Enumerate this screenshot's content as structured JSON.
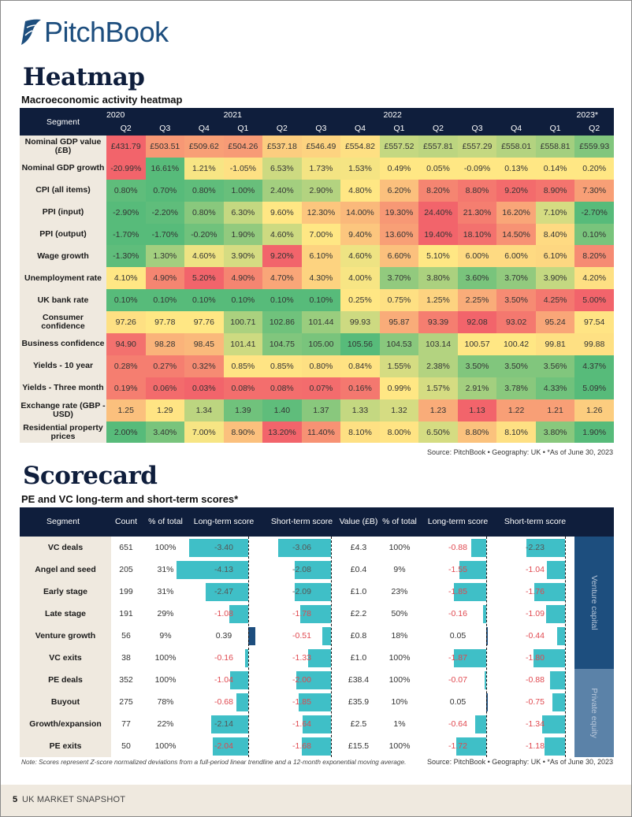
{
  "brand": {
    "name": "PitchBook",
    "logo_icon": "pitchbook-sail-icon",
    "color": "#1d4e7e"
  },
  "heatmap_section": {
    "title": "Heatmap",
    "subtitle": "Macroeconomic activity heatmap",
    "segment_header": "Segment",
    "years": [
      {
        "label": "2020",
        "span": 3
      },
      {
        "label": "2021",
        "span": 4
      },
      {
        "label": "2022",
        "span": 4
      },
      {
        "label": "2023*",
        "span": 2
      }
    ],
    "quarters": [
      "Q2",
      "Q3",
      "Q4",
      "Q1",
      "Q2",
      "Q3",
      "Q4",
      "Q1",
      "Q2",
      "Q3",
      "Q4",
      "Q1",
      "Q2"
    ],
    "color_scale": {
      "good": "#57bb7a",
      "neutral": "#ffe784",
      "bad": "#f2646b"
    },
    "rows": [
      {
        "label": "Nominal GDP value (£B)",
        "values": [
          "£431.79",
          "£503.51",
          "£509.62",
          "£504.26",
          "£537.18",
          "£546.49",
          "£554.82",
          "£557.52",
          "£557.81",
          "£557.29",
          "£558.01",
          "£558.81",
          "£559.93"
        ],
        "tones": [
          1,
          0.6,
          0.55,
          0.58,
          0.2,
          0.15,
          0.05,
          -0.35,
          -0.4,
          -0.35,
          -0.45,
          -0.55,
          -0.75
        ]
      },
      {
        "label": "Nominal GDP growth",
        "values": [
          "-20.99%",
          "16.61%",
          "1.21%",
          "-1.05%",
          "6.53%",
          "1.73%",
          "1.53%",
          "0.49%",
          "0.05%",
          "-0.09%",
          "0.13%",
          "0.14%",
          "0.20%"
        ],
        "tones": [
          1,
          -1,
          -0.05,
          0.05,
          -0.3,
          -0.07,
          -0.06,
          0,
          0,
          0,
          0,
          0,
          0
        ]
      },
      {
        "label": "CPI (all items)",
        "values": [
          "0.80%",
          "0.70%",
          "0.80%",
          "1.00%",
          "2.40%",
          "2.90%",
          "4.80%",
          "6.20%",
          "8.20%",
          "8.80%",
          "9.20%",
          "8.90%",
          "7.30%"
        ],
        "tones": [
          -0.95,
          -1,
          -0.95,
          -0.9,
          -0.55,
          -0.45,
          0,
          0.3,
          0.75,
          0.85,
          0.95,
          0.88,
          0.55
        ]
      },
      {
        "label": "PPI (input)",
        "values": [
          "-2.90%",
          "-2.20%",
          "0.80%",
          "6.30%",
          "9.60%",
          "12.30%",
          "14.00%",
          "19.30%",
          "24.40%",
          "21.30%",
          "16.20%",
          "7.10%",
          "-2.70%"
        ],
        "tones": [
          -1,
          -0.95,
          -0.7,
          -0.35,
          0,
          0.25,
          0.35,
          0.6,
          1,
          0.8,
          0.5,
          -0.25,
          -1
        ]
      },
      {
        "label": "PPI (output)",
        "values": [
          "-1.70%",
          "-1.70%",
          "-0.20%",
          "1.90%",
          "4.60%",
          "7.00%",
          "9.40%",
          "13.60%",
          "19.40%",
          "18.10%",
          "14.50%",
          "8.40%",
          "0.10%"
        ],
        "tones": [
          -1,
          -1,
          -0.85,
          -0.65,
          -0.3,
          0,
          0.25,
          0.55,
          1,
          0.9,
          0.65,
          0.1,
          -0.8
        ]
      },
      {
        "label": "Wage growth",
        "values": [
          "-1.30%",
          "1.30%",
          "4.60%",
          "3.90%",
          "9.20%",
          "6.10%",
          "4.60%",
          "6.60%",
          "5.10%",
          "6.00%",
          "6.00%",
          "6.10%",
          "8.20%"
        ],
        "tones": [
          -0.95,
          -0.55,
          -0.1,
          -0.25,
          1,
          0.15,
          -0.1,
          0.3,
          0,
          0.1,
          0.1,
          0.12,
          0.7
        ]
      },
      {
        "label": "Unemployment rate",
        "values": [
          "4.10%",
          "4.90%",
          "5.20%",
          "4.90%",
          "4.70%",
          "4.30%",
          "4.00%",
          "3.70%",
          "3.80%",
          "3.60%",
          "3.70%",
          "3.90%",
          "4.20%"
        ],
        "tones": [
          0,
          0.75,
          1,
          0.75,
          0.5,
          0.15,
          -0.05,
          -0.65,
          -0.5,
          -0.8,
          -0.65,
          -0.35,
          0.05
        ]
      },
      {
        "label": "UK bank rate",
        "values": [
          "0.10%",
          "0.10%",
          "0.10%",
          "0.10%",
          "0.10%",
          "0.10%",
          "0.25%",
          "0.75%",
          "1.25%",
          "2.25%",
          "3.50%",
          "4.25%",
          "5.00%"
        ],
        "tones": [
          -1,
          -1,
          -1,
          -1,
          -1,
          -1,
          0,
          0.05,
          0.15,
          0.45,
          0.7,
          0.85,
          1
        ]
      },
      {
        "label": "Consumer confidence",
        "values": [
          "97.26",
          "97.78",
          "97.76",
          "100.71",
          "102.86",
          "101.44",
          "99.93",
          "95.87",
          "93.39",
          "92.08",
          "93.02",
          "95.24",
          "97.54"
        ],
        "tones": [
          0.05,
          0,
          0,
          -0.5,
          -0.85,
          -0.6,
          -0.3,
          0.45,
          0.8,
          1,
          0.85,
          0.5,
          0.02
        ]
      },
      {
        "label": "Business confidence",
        "values": [
          "94.90",
          "98.28",
          "98.45",
          "101.41",
          "104.75",
          "105.00",
          "105.56",
          "104.53",
          "103.14",
          "100.57",
          "100.42",
          "99.81",
          "99.88"
        ],
        "tones": [
          0.9,
          0.4,
          0.35,
          -0.3,
          -0.75,
          -0.8,
          -1,
          -0.7,
          -0.45,
          0,
          0,
          0.05,
          0.05
        ]
      },
      {
        "label": "Yields - 10 year",
        "values": [
          "0.28%",
          "0.27%",
          "0.32%",
          "0.85%",
          "0.85%",
          "0.80%",
          "0.84%",
          "1.55%",
          "2.38%",
          "3.50%",
          "3.50%",
          "3.56%",
          "4.37%"
        ],
        "tones": [
          0.8,
          0.8,
          0.7,
          0.02,
          0.02,
          0.05,
          0.03,
          -0.25,
          -0.45,
          -0.75,
          -0.75,
          -0.75,
          -1
        ]
      },
      {
        "label": "Yields - Three month",
        "values": [
          "0.19%",
          "0.06%",
          "0.03%",
          "0.08%",
          "0.08%",
          "0.07%",
          "0.16%",
          "0.99%",
          "1.57%",
          "2.91%",
          "3.78%",
          "4.33%",
          "5.09%"
        ],
        "tones": [
          0.8,
          0.95,
          1,
          0.92,
          0.92,
          0.94,
          0.85,
          0,
          -0.25,
          -0.55,
          -0.7,
          -0.85,
          -1
        ]
      },
      {
        "label": "Exchange rate (GBP - USD)",
        "values": [
          "1.25",
          "1.29",
          "1.34",
          "1.39",
          "1.40",
          "1.37",
          "1.33",
          "1.32",
          "1.23",
          "1.13",
          "1.22",
          "1.21",
          "1.26"
        ],
        "tones": [
          0.3,
          0.02,
          -0.4,
          -0.85,
          -0.95,
          -0.7,
          -0.35,
          -0.25,
          0.45,
          1,
          0.55,
          0.55,
          0.2
        ]
      },
      {
        "label": "Residential property prices",
        "values": [
          "2.00%",
          "3.40%",
          "7.00%",
          "8.90%",
          "13.20%",
          "11.40%",
          "8.10%",
          "8.00%",
          "6.50%",
          "8.80%",
          "8.10%",
          "3.80%",
          "1.90%"
        ],
        "tones": [
          -1,
          -0.8,
          -0.05,
          0.3,
          1,
          0.65,
          0.05,
          0.02,
          -0.25,
          0.28,
          0.05,
          -0.7,
          -1
        ]
      }
    ],
    "source": "Source: PitchBook • Geography: UK • *As of June 30, 2023"
  },
  "scorecard_section": {
    "title": "Scorecard",
    "subtitle": "PE and VC long-term and short-term scores*",
    "headers": {
      "segment": "Segment",
      "count": "Count",
      "count_pct": "% of total",
      "count_lt": "Long-term score",
      "count_st": "Short-term score",
      "value": "Value (£B)",
      "value_pct": "% of total",
      "value_lt": "Long-term score",
      "value_st": "Short-term score"
    },
    "groups": [
      {
        "label": "Venture capital",
        "color": "#1d4e7e",
        "rows": 6
      },
      {
        "label": "Private equity",
        "color": "#5b82a8",
        "rows": 4
      }
    ],
    "bar_colors": {
      "negative": "#3fbfc7",
      "positive": "#1d4e7e"
    },
    "rows": [
      {
        "segment": "VC deals",
        "count": "651",
        "count_pct": "100%",
        "count_lt": -3.4,
        "count_st": -3.06,
        "value": "£4.3",
        "value_pct": "100%",
        "value_lt": -0.88,
        "value_st": -2.23
      },
      {
        "segment": "Angel and seed",
        "count": "205",
        "count_pct": "31%",
        "count_lt": -4.13,
        "count_st": -2.08,
        "value": "£0.4",
        "value_pct": "9%",
        "value_lt": -1.55,
        "value_st": -1.04
      },
      {
        "segment": "Early stage",
        "count": "199",
        "count_pct": "31%",
        "count_lt": -2.47,
        "count_st": -2.09,
        "value": "£1.0",
        "value_pct": "23%",
        "value_lt": -1.85,
        "value_st": -1.76
      },
      {
        "segment": "Late stage",
        "count": "191",
        "count_pct": "29%",
        "count_lt": -1.08,
        "count_st": -1.78,
        "value": "£2.2",
        "value_pct": "50%",
        "value_lt": -0.16,
        "value_st": -1.09
      },
      {
        "segment": "Venture growth",
        "count": "56",
        "count_pct": "9%",
        "count_lt": 0.39,
        "count_st": -0.51,
        "value": "£0.8",
        "value_pct": "18%",
        "value_lt": 0.05,
        "value_st": -0.44
      },
      {
        "segment": "VC exits",
        "count": "38",
        "count_pct": "100%",
        "count_lt": -0.16,
        "count_st": -1.33,
        "value": "£1.0",
        "value_pct": "100%",
        "value_lt": -1.87,
        "value_st": -1.8
      },
      {
        "segment": "PE deals",
        "count": "352",
        "count_pct": "100%",
        "count_lt": -1.04,
        "count_st": -2.0,
        "value": "£38.4",
        "value_pct": "100%",
        "value_lt": -0.07,
        "value_st": -0.88
      },
      {
        "segment": "Buyout",
        "count": "275",
        "count_pct": "78%",
        "count_lt": -0.68,
        "count_st": -1.85,
        "value": "£35.9",
        "value_pct": "10%",
        "value_lt": 0.05,
        "value_st": -0.75
      },
      {
        "segment": "Growth/expansion",
        "count": "77",
        "count_pct": "22%",
        "count_lt": -2.14,
        "count_st": -1.64,
        "value": "£2.5",
        "value_pct": "1%",
        "value_lt": -0.64,
        "value_st": -1.34
      },
      {
        "segment": "PE exits",
        "count": "50",
        "count_pct": "100%",
        "count_lt": -2.04,
        "count_st": -1.68,
        "value": "£15.5",
        "value_pct": "100%",
        "value_lt": -1.72,
        "value_st": -1.18
      }
    ],
    "note": "Note: Scores represent Z-score normalized deviations from a full-period linear trendline and a 12-month exponential moving average.",
    "source": "Source: PitchBook • Geography: UK • *As of June 30, 2023"
  },
  "footer": {
    "page_number": "5",
    "title": "UK MARKET SNAPSHOT"
  }
}
